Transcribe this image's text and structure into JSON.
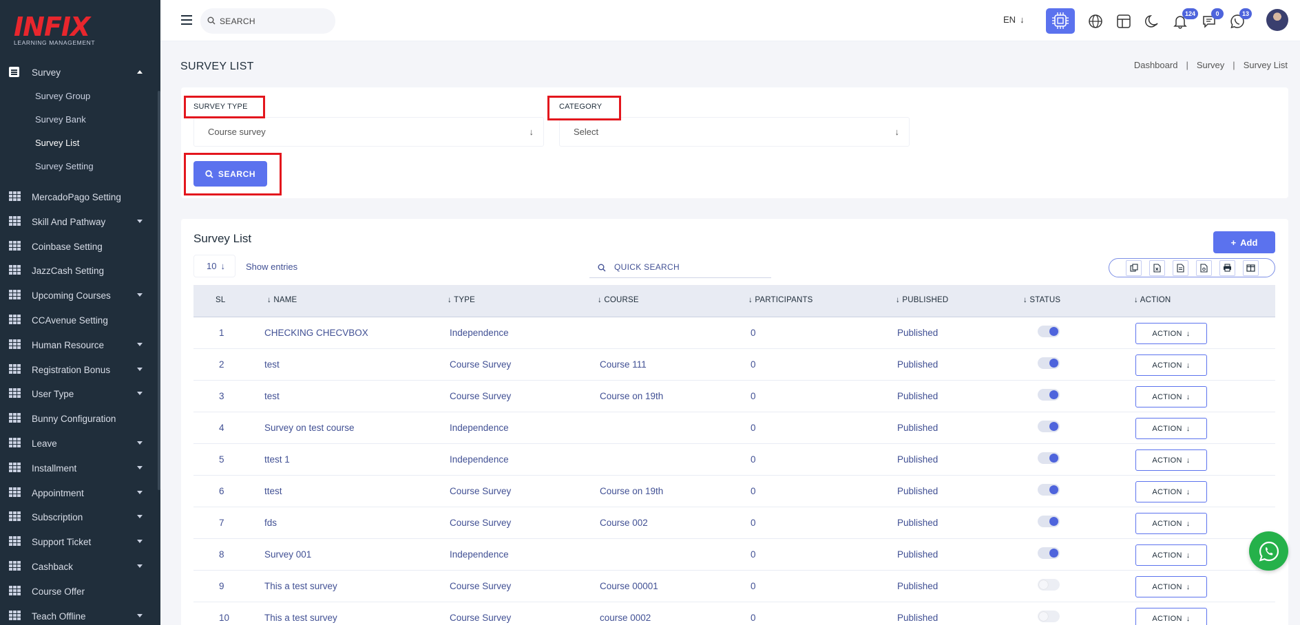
{
  "app": {
    "logo_text": "INFIX",
    "logo_sub": "LEARNING MANAGEMENT"
  },
  "sidebar": {
    "survey": {
      "label": "Survey",
      "icon": "document-icon"
    },
    "survey_sub": [
      {
        "label": "Survey Group",
        "active": false
      },
      {
        "label": "Survey Bank",
        "active": false
      },
      {
        "label": "Survey List",
        "active": true
      },
      {
        "label": "Survey Setting",
        "active": false
      }
    ],
    "items": [
      {
        "label": "MercadoPago Setting",
        "caret": false
      },
      {
        "label": "Skill And Pathway",
        "caret": true
      },
      {
        "label": "Coinbase Setting",
        "caret": false
      },
      {
        "label": "JazzCash Setting",
        "caret": false
      },
      {
        "label": "Upcoming Courses",
        "caret": true
      },
      {
        "label": "CCAvenue Setting",
        "caret": false
      },
      {
        "label": "Human Resource",
        "caret": true
      },
      {
        "label": "Registration Bonus",
        "caret": true
      },
      {
        "label": "User Type",
        "caret": true
      },
      {
        "label": "Bunny Configuration",
        "caret": false
      },
      {
        "label": "Leave",
        "caret": true
      },
      {
        "label": "Installment",
        "caret": true
      },
      {
        "label": "Appointment",
        "caret": true
      },
      {
        "label": "Subscription",
        "caret": true
      },
      {
        "label": "Support Ticket",
        "caret": true
      },
      {
        "label": "Cashback",
        "caret": true
      },
      {
        "label": "Course Offer",
        "caret": false
      },
      {
        "label": "Teach Offline",
        "caret": true
      }
    ]
  },
  "topbar": {
    "search_placeholder": "SEARCH",
    "lang": "EN",
    "badges": {
      "notifications": "124",
      "messages": "0",
      "whatsapp": "13"
    }
  },
  "page": {
    "title": "SURVEY LIST",
    "breadcrumb": [
      "Dashboard",
      "Survey",
      "Survey List"
    ]
  },
  "filters": {
    "survey_type_label": "SURVEY TYPE",
    "survey_type_value": "Course survey",
    "category_label": "CATEGORY",
    "category_value": "Select",
    "search_label": "SEARCH"
  },
  "list": {
    "title": "Survey List",
    "add_label": "Add",
    "entries_value": "10",
    "show_entries": "Show entries",
    "quick_search": "QUICK SEARCH",
    "columns": [
      "SL",
      "NAME",
      "TYPE",
      "COURSE",
      "PARTICIPANTS",
      "PUBLISHED",
      "STATUS",
      "ACTION"
    ],
    "action_label": "ACTION",
    "rows": [
      {
        "sl": "1",
        "name": "CHECKING CHECVBOX",
        "type": "Independence",
        "course": "",
        "participants": "0",
        "published": "Published",
        "status_on": true
      },
      {
        "sl": "2",
        "name": "test",
        "type": "Course Survey",
        "course": "Course 111",
        "participants": "0",
        "published": "Published",
        "status_on": true
      },
      {
        "sl": "3",
        "name": "test",
        "type": "Course Survey",
        "course": "Course on 19th",
        "participants": "0",
        "published": "Published",
        "status_on": true
      },
      {
        "sl": "4",
        "name": "Survey on test course",
        "type": "Independence",
        "course": "",
        "participants": "0",
        "published": "Published",
        "status_on": true
      },
      {
        "sl": "5",
        "name": "ttest 1",
        "type": "Independence",
        "course": "",
        "participants": "0",
        "published": "Published",
        "status_on": true
      },
      {
        "sl": "6",
        "name": "ttest",
        "type": "Course Survey",
        "course": "Course on 19th",
        "participants": "0",
        "published": "Published",
        "status_on": true
      },
      {
        "sl": "7",
        "name": "fds",
        "type": "Course Survey",
        "course": "Course 002",
        "participants": "0",
        "published": "Published",
        "status_on": true
      },
      {
        "sl": "8",
        "name": "Survey 001",
        "type": "Independence",
        "course": "",
        "participants": "0",
        "published": "Published",
        "status_on": true
      },
      {
        "sl": "9",
        "name": "This a test survey",
        "type": "Course Survey",
        "course": "Course 00001",
        "participants": "0",
        "published": "Published",
        "status_on": false
      },
      {
        "sl": "10",
        "name": "This a test survey",
        "type": "Course Survey",
        "course": "course 0002",
        "participants": "0",
        "published": "Published",
        "status_on": false
      }
    ]
  },
  "colors": {
    "sidebar_bg": "#202e3b",
    "accent": "#5b72ee",
    "highlight_box": "#e3161d",
    "whatsapp": "#25b14a"
  }
}
